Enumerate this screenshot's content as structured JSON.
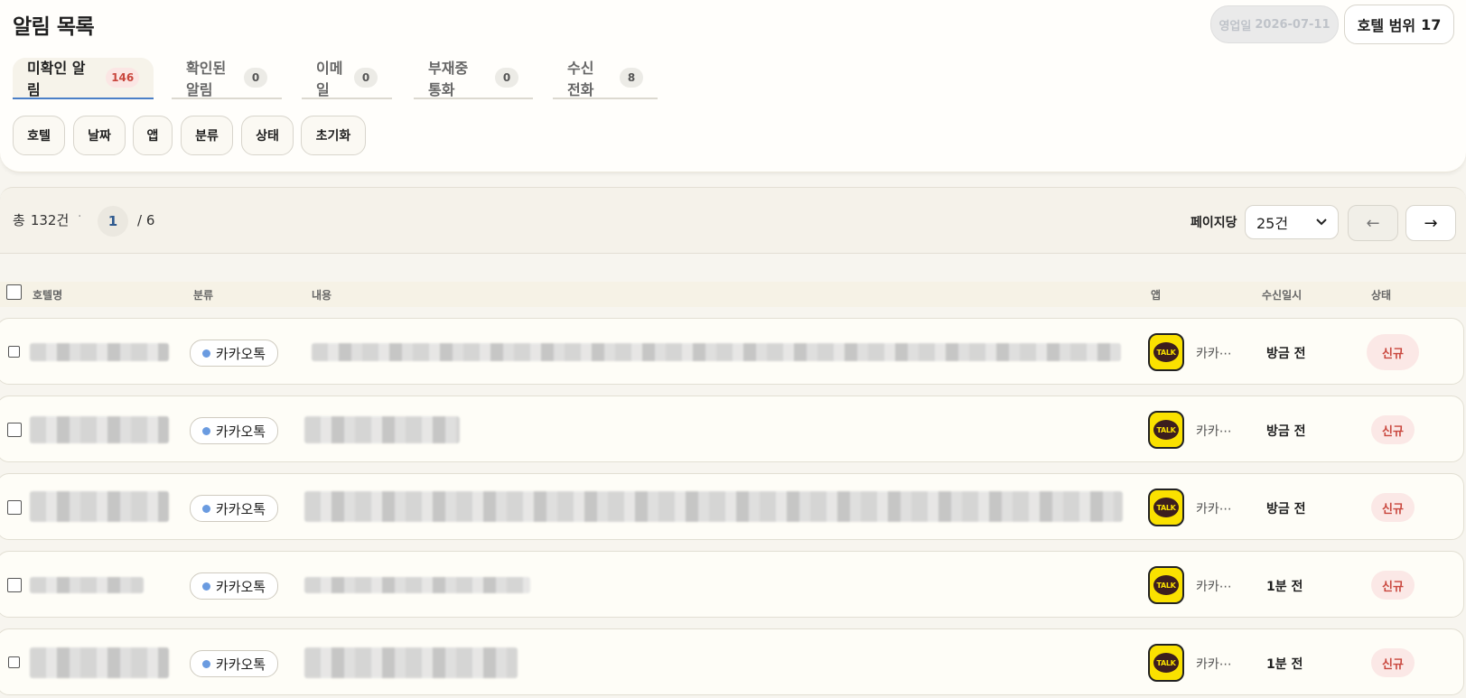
{
  "header": {
    "title": "알림 목록",
    "business_date_label": "영업일",
    "business_date": "2026-07-11",
    "hotel_range_label": "호텔 범위",
    "hotel_range_count": "17"
  },
  "tabs": [
    {
      "label": "미확인 알림",
      "count": "146"
    },
    {
      "label": "확인된 알림",
      "count": "0"
    },
    {
      "label": "이메일",
      "count": "0"
    },
    {
      "label": "부재중 통화",
      "count": "0"
    },
    {
      "label": "수신 전화",
      "count": "8"
    }
  ],
  "filters": [
    "호텔",
    "날짜",
    "앱",
    "분류",
    "상태",
    "초기화"
  ],
  "pagination": {
    "total_label": "총",
    "total_count": "132건",
    "separator": "·",
    "current_page": "1",
    "total_pages": "/ 6",
    "per_page_label": "페이지당",
    "per_page_value": "25건",
    "prev": "←",
    "next": "→"
  },
  "table": {
    "columns": {
      "hotel": "호텔명",
      "category": "분류",
      "content": "내용",
      "app": "앱",
      "received": "수신일시",
      "status": "상태"
    },
    "rows": [
      {
        "category": "카카오톡",
        "app_icon": "TALK",
        "app_name": "카카⋯",
        "received": "방금 전",
        "status": "신규"
      },
      {
        "category": "카카오톡",
        "app_icon": "TALK",
        "app_name": "카카⋯",
        "received": "방금 전",
        "status": "신규"
      },
      {
        "category": "카카오톡",
        "app_icon": "TALK",
        "app_name": "카카⋯",
        "received": "방금 전",
        "status": "신규"
      },
      {
        "category": "카카오톡",
        "app_icon": "TALK",
        "app_name": "카카⋯",
        "received": "1분 전",
        "status": "신규"
      },
      {
        "category": "카카오톡",
        "app_icon": "TALK",
        "app_name": "카카⋯",
        "received": "1분 전",
        "status": "신규"
      }
    ]
  },
  "colors": {
    "accent_blue": "#4a7fc7",
    "category_dot": "#6a9be0",
    "status_red": "#c9473e",
    "kakao_yellow": "#fae100"
  }
}
